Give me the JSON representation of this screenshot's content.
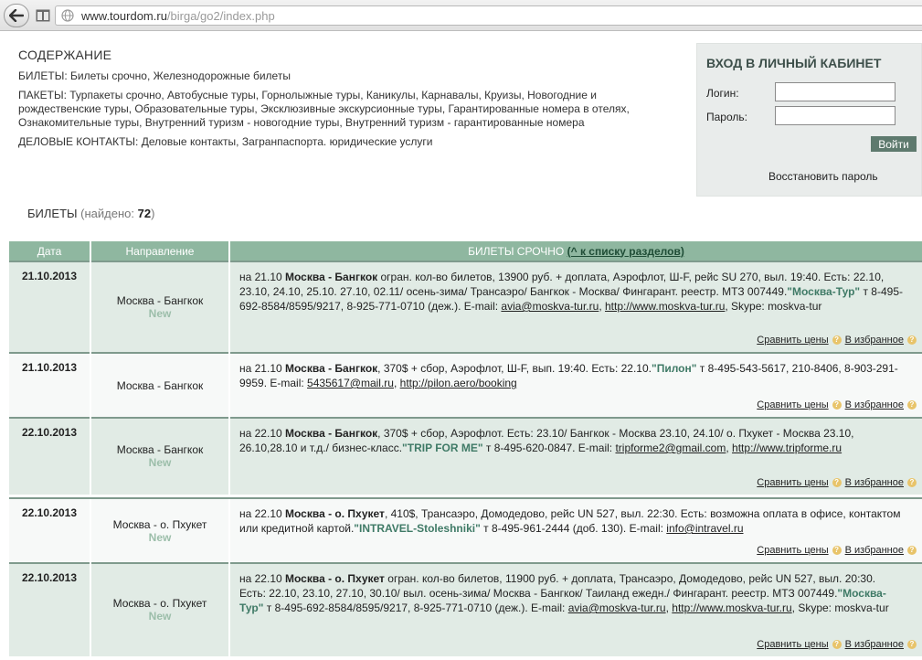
{
  "browser": {
    "url_domain": "www.tourdom.ru",
    "url_path": "/birga/go2/index.php",
    "url_prefix": ""
  },
  "contents": {
    "title": "СОДЕРЖАНИЕ",
    "sections": [
      {
        "label": "БИЛЕТЫ:",
        "text": "Билеты срочно, Железнодорожные билеты"
      },
      {
        "label": "ПАКЕТЫ:",
        "text": "Турпакеты срочно, Автобусные туры, Горнолыжные туры, Каникулы, Карнавалы, Круизы, Новогодние и рождественские туры, Образовательные туры, Эксклюзивные экскурсионные туры, Гарантированные номера в отелях, Ознакомительные туры, Внутренний туризм - новогодние туры, Внутренний туризм - гарантированные номера"
      },
      {
        "label": "ДЕЛОВЫЕ КОНТАКТЫ:",
        "text": "Деловые контакты, Загранпаспорта. юридические услуги"
      }
    ]
  },
  "login": {
    "title": "ВХОД В ЛИЧНЫЙ КАБИНЕТ",
    "login_label": "Логин:",
    "password_label": "Пароль:",
    "login_value": "",
    "password_value": "",
    "submit": "Войти",
    "restore": "Восстановить пароль"
  },
  "results": {
    "title": "БИЛЕТЫ",
    "found_label": "(найдено:",
    "count": "72",
    "found_close": ")"
  },
  "table": {
    "headers": {
      "date": "Дата",
      "direction": "Направление",
      "section": "БИЛЕТЫ СРОЧНО",
      "back_link": "(^ к списку разделов)"
    },
    "compare": "Сравнить цены",
    "favorite": "В избранное",
    "help_glyph": "?",
    "rows": [
      {
        "date": "21.10.2013",
        "direction": "Москва - Бангкок",
        "new": "New",
        "lead": "на 21.10",
        "route": "Москва - Бангкок",
        "body": "огран. кол-во билетов, 13900 руб. + доплата, Аэрофлот, Ш-F, рейс SU 270, выл. 19:40. Есть: 22.10, 23.10, 24.10, 25.10. 27.10, 02.11/ осень-зима/ Трансаэро/ Бангкок - Москва/ Фингарант. реестр. МТЗ 007449.",
        "company": "\"Москва-Тур\"",
        "tail": "т 8-495-692-8584/8595/9217, 8-925-771-0710 (деж.). E-mail:",
        "email": "avia@moskva-tur.ru",
        "sep": ",",
        "site": "http://www.moskva-tur.ru",
        "extra": ", Skype: moskva-tur"
      },
      {
        "date": "21.10.2013",
        "direction": "Москва - Бангкок",
        "new": "",
        "lead": "на 21.10",
        "route": "Москва - Бангкок",
        "body": ", 370$ + сбор, Аэрофлот, Ш-F, вып. 19:40. Есть: 22.10.",
        "company": "\"Пилон\"",
        "tail": "т 8-495-543-5617, 210-8406, 8-903-291-9959. E-mail:",
        "email": "5435617@mail.ru",
        "sep": ",",
        "site": "http://pilon.aero/booking",
        "extra": ""
      },
      {
        "date": "22.10.2013",
        "direction": "Москва - Бангкок",
        "new": "New",
        "lead": "на 22.10",
        "route": "Москва - Бангкок",
        "body": ", 370$ + сбор, Аэрофлот. Есть: 23.10/ Бангкок - Москва 23.10, 24.10/ о. Пхукет - Москва 23.10, 26.10,28.10 и т.д./ бизнес-класс.",
        "company": "\"TRIP FOR ME\"",
        "tail": "т 8-495-620-0847. E-mail:",
        "email": "tripforme2@gmail.com",
        "sep": ",",
        "site": "http://www.tripforme.ru",
        "extra": ""
      },
      {
        "date": "22.10.2013",
        "direction": "Москва - о. Пхукет",
        "new": "New",
        "lead": "на 22.10",
        "route": "Москва - о. Пхукет",
        "body": ", 410$, Трансаэро, Домодедово, рейс UN 527, выл. 22:30. Есть: возможна оплата в офисе, контактом или кредитной картой.",
        "company": "\"INTRAVEL-Stoleshniki\"",
        "tail": "т 8-495-961-2444 (доб. 130). E-mail:",
        "email": "info@intravel.ru",
        "sep": "",
        "site": "",
        "extra": ""
      },
      {
        "date": "22.10.2013",
        "direction": "Москва - о. Пхукет",
        "new": "New",
        "lead": "на 22.10",
        "route": "Москва - о. Пхукет",
        "body": "огран. кол-во билетов, 11900 руб. + доплата, Трансаэро, Домодедово, рейс UN 527, выл. 20:30. Есть: 22.10, 23.10, 27.10, 30.10/ выл. осень-зима/ Москва - Бангкок/ Таиланд ежедн./ Фингарант. реестр. МТЗ 007449.",
        "company": "\"Москва-Тур\"",
        "tail": "т 8-495-692-8584/8595/9217, 8-925-771-0710 (деж.). E-mail:",
        "email": "avia@moskva-tur.ru",
        "sep": ",",
        "site": "http://www.moskva-tur.ru",
        "extra": ", Skype: moskva-tur"
      }
    ]
  }
}
